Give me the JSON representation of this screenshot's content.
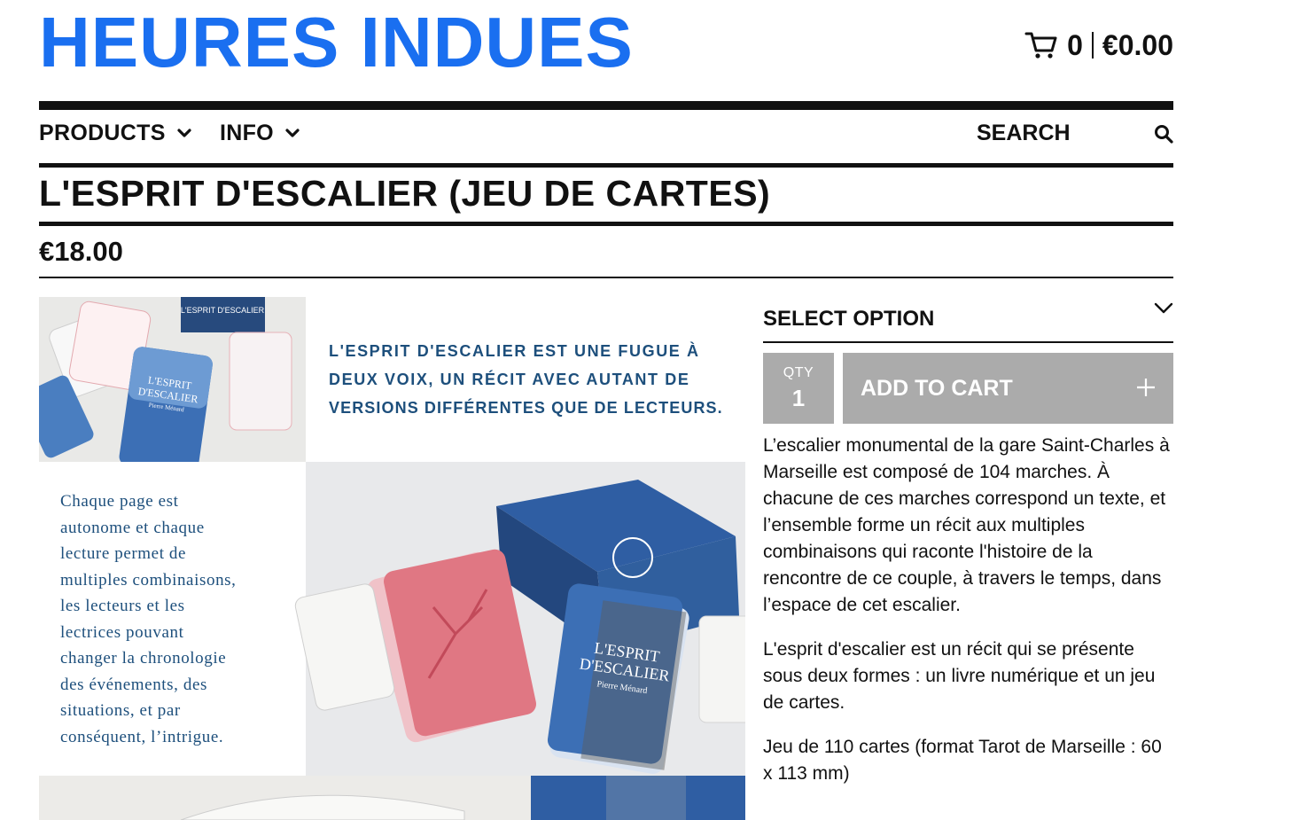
{
  "header": {
    "brand": "HEURES INDUES",
    "cart": {
      "count": "0",
      "total": "€0.00"
    }
  },
  "nav": {
    "items": [
      {
        "label": "PRODUCTS"
      },
      {
        "label": "INFO"
      }
    ],
    "search": {
      "label": "SEARCH"
    }
  },
  "product": {
    "title": "L'ESPRIT D'ESCALIER (JEU DE CARTES)",
    "price": "€18.00",
    "image": {
      "headline": [
        "L'ESPRIT D'ESCALIER EST UNE FUGUE À",
        "DEUX VOIX, UN RÉCIT AVEC AUTANT DE",
        "VERSIONS DIFFÉRENTES QUE DE LECTEURS."
      ],
      "side_text": [
        "Chaque page est",
        "autonome et chaque",
        "lecture permet de",
        "multiples combinaisons,",
        "les lecteurs et les",
        "lectrices pouvant",
        "changer la chronologie",
        "des événements, des",
        "situations, et par",
        "conséquent, l’intrigue."
      ],
      "box_label": "L'ESPRIT D'ESCALIER",
      "card_title": [
        "L'ESPRIT",
        "D'ESCALIER"
      ],
      "card_author": "Pierre Ménard"
    },
    "select_option": "SELECT OPTION",
    "qty": {
      "label": "QTY",
      "value": "1"
    },
    "add_to_cart": "ADD TO CART",
    "description": [
      "L’escalier monumental de la gare Saint-Charles à Marseille est composé de 104 marches. À chacune de ces marches correspond un texte, et l’ensemble forme un récit aux multiples combinaisons qui raconte l'histoire de la rencontre de ce couple, à travers le temps, dans l’espace de cet escalier.",
      "L'esprit d'escalier est un récit qui se présente sous deux formes : un livre numérique et un jeu de cartes.",
      "Jeu de 110 cartes (format Tarot de Marseille : 60 x 113 mm)"
    ]
  },
  "colors": {
    "brand": "#1a6ff0",
    "button_gray": "#ababab",
    "headline_blue": "#1d4f7c",
    "card_red": "#e0707a",
    "card_blue": "#3c6fb5"
  }
}
